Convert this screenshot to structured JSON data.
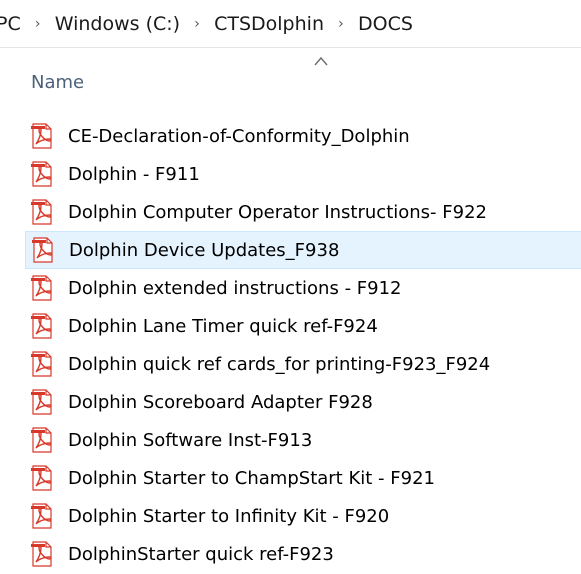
{
  "breadcrumb": {
    "segments": [
      "PC",
      "Windows (C:)",
      "CTSDolphin",
      "DOCS"
    ],
    "separator": "›"
  },
  "column_header": {
    "name": "Name",
    "sort": "ascending"
  },
  "files": [
    {
      "name": "CE-Declaration-of-Conformity_Dolphin",
      "icon": "pdf-icon",
      "selected": false
    },
    {
      "name": "Dolphin - F911",
      "icon": "pdf-icon",
      "selected": false
    },
    {
      "name": "Dolphin Computer Operator Instructions- F922",
      "icon": "pdf-icon",
      "selected": false
    },
    {
      "name": "Dolphin Device Updates_F938",
      "icon": "pdf-icon",
      "selected": true
    },
    {
      "name": "Dolphin extended instructions - F912",
      "icon": "pdf-icon",
      "selected": false
    },
    {
      "name": "Dolphin Lane Timer quick ref-F924",
      "icon": "pdf-icon",
      "selected": false
    },
    {
      "name": "Dolphin quick ref cards_for printing-F923_F924",
      "icon": "pdf-icon",
      "selected": false
    },
    {
      "name": "Dolphin Scoreboard Adapter F928",
      "icon": "pdf-icon",
      "selected": false
    },
    {
      "name": "Dolphin Software Inst-F913",
      "icon": "pdf-icon",
      "selected": false
    },
    {
      "name": "Dolphin Starter to ChampStart Kit - F921",
      "icon": "pdf-icon",
      "selected": false
    },
    {
      "name": "Dolphin Starter to Infinity Kit - F920",
      "icon": "pdf-icon",
      "selected": false
    },
    {
      "name": "DolphinStarter quick ref-F923",
      "icon": "pdf-icon",
      "selected": false
    }
  ],
  "colors": {
    "selection_bg": "#e5f3ff",
    "selection_border": "#cce8ff",
    "header_text": "#4c607a",
    "pdf_red": "#d8382a"
  }
}
